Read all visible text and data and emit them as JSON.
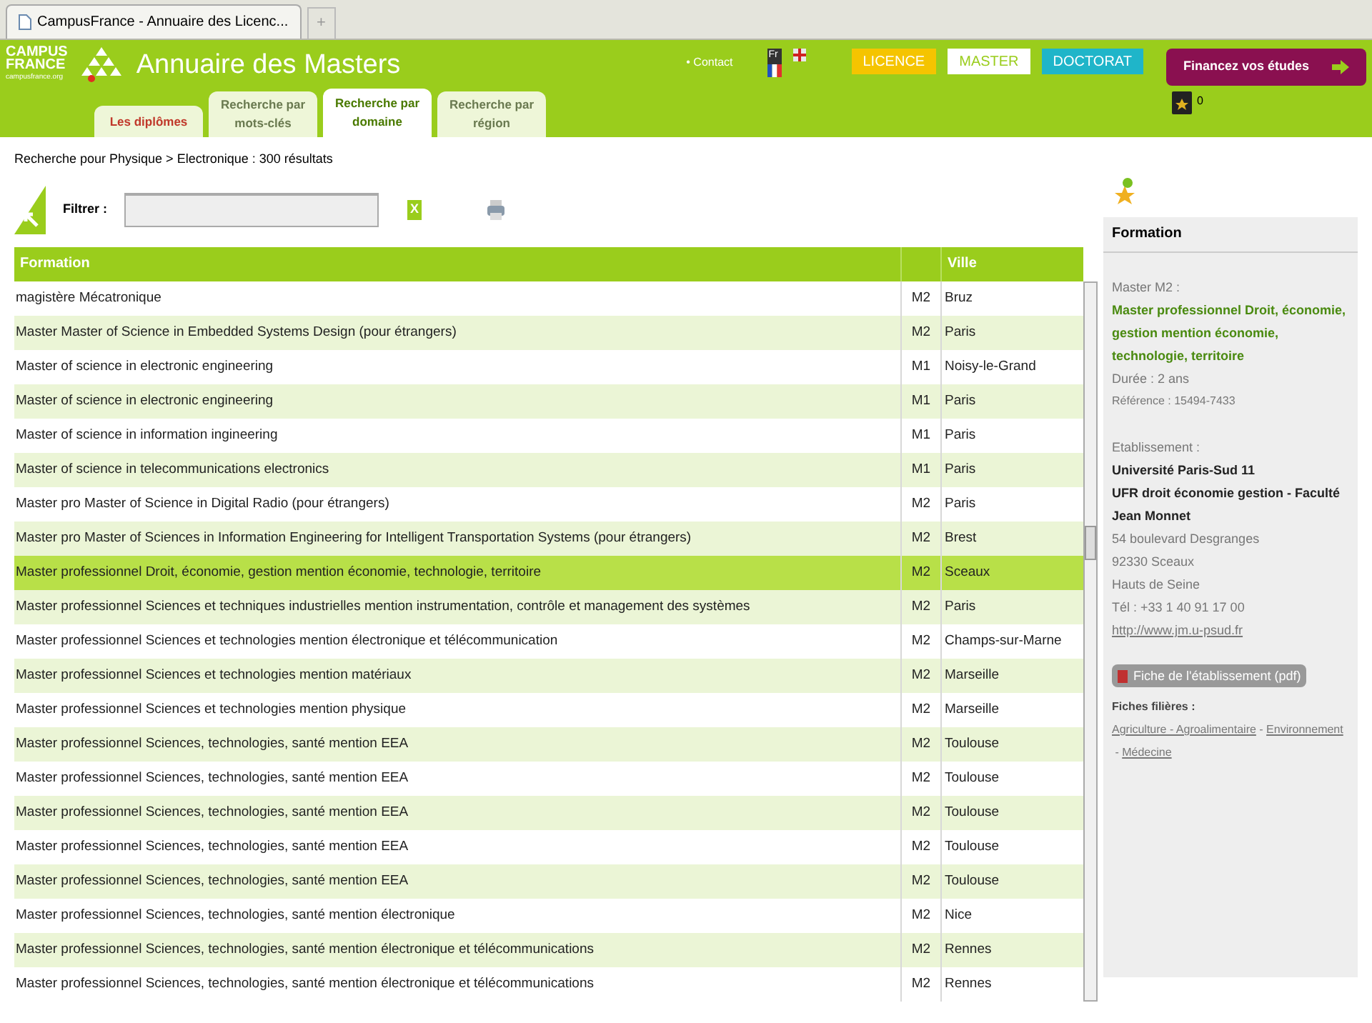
{
  "browser_tab": {
    "title": "CampusFrance - Annuaire des Licenc...",
    "new_tab": "+"
  },
  "header": {
    "logo_line1": "CAMPUS",
    "logo_line2": "FRANCE",
    "logo_url": "campusfrance.org",
    "title": "Annuaire des Masters",
    "contact": "• Contact",
    "language": "Fr",
    "favorites_count": "0",
    "finance_button": "Financez vos études"
  },
  "levels": [
    {
      "label": "LICENCE",
      "color": "#f5c400",
      "selected": false
    },
    {
      "label": "MASTER",
      "color": "#ffffff",
      "selected": true
    },
    {
      "label": "DOCTORAT",
      "color": "#1fb5c9",
      "selected": false
    }
  ],
  "tabs": [
    {
      "label": "Les diplômes",
      "selected": false,
      "kind": "main"
    },
    {
      "label": "Recherche par mots-clés",
      "selected": false,
      "kind": "search"
    },
    {
      "label": "Recherche par domaine",
      "selected": true,
      "kind": "search"
    },
    {
      "label": "Recherche par région",
      "selected": false,
      "kind": "search"
    }
  ],
  "breadcrumb": "Recherche pour Physique > Electronique : 300 résultats",
  "filter": {
    "label": "Filtrer :",
    "clear": "X"
  },
  "table": {
    "columns": [
      "Formation",
      "Ville"
    ],
    "rows": [
      {
        "formation": "magistère Mécatronique",
        "level": "M2",
        "city": "Bruz",
        "selected": false
      },
      {
        "formation": "Master Master of Science in Embedded Systems Design (pour étrangers)",
        "level": "M2",
        "city": "Paris",
        "selected": false
      },
      {
        "formation": "Master of science in electronic engineering",
        "level": "M1",
        "city": "Noisy-le-Grand",
        "selected": false
      },
      {
        "formation": "Master of science in electronic engineering",
        "level": "M1",
        "city": "Paris",
        "selected": false
      },
      {
        "formation": "Master of science in information ingineering",
        "level": "M1",
        "city": "Paris",
        "selected": false
      },
      {
        "formation": "Master of science in telecommunications electronics",
        "level": "M1",
        "city": "Paris",
        "selected": false
      },
      {
        "formation": "Master pro Master of Science in Digital Radio (pour étrangers)",
        "level": "M2",
        "city": "Paris",
        "selected": false
      },
      {
        "formation": "Master pro Master of Sciences in Information Engineering for Intelligent Transportation Systems (pour étrangers)",
        "level": "M2",
        "city": "Brest",
        "selected": false
      },
      {
        "formation": "Master professionnel Droit, économie, gestion mention économie, technologie, territoire",
        "level": "M2",
        "city": "Sceaux",
        "selected": true
      },
      {
        "formation": "Master professionnel Sciences et techniques industrielles mention instrumentation, contrôle et management des systèmes",
        "level": "M2",
        "city": "Paris",
        "selected": false
      },
      {
        "formation": "Master professionnel Sciences et technologies mention électronique et télécommunication",
        "level": "M2",
        "city": "Champs-sur-Marne",
        "selected": false
      },
      {
        "formation": "Master professionnel Sciences et technologies mention matériaux",
        "level": "M2",
        "city": "Marseille",
        "selected": false
      },
      {
        "formation": "Master professionnel Sciences et technologies mention physique",
        "level": "M2",
        "city": "Marseille",
        "selected": false
      },
      {
        "formation": "Master professionnel Sciences, technologies, santé mention EEA",
        "level": "M2",
        "city": "Toulouse",
        "selected": false
      },
      {
        "formation": "Master professionnel Sciences, technologies, santé mention EEA",
        "level": "M2",
        "city": "Toulouse",
        "selected": false
      },
      {
        "formation": "Master professionnel Sciences, technologies, santé mention EEA",
        "level": "M2",
        "city": "Toulouse",
        "selected": false
      },
      {
        "formation": "Master professionnel Sciences, technologies, santé mention EEA",
        "level": "M2",
        "city": "Toulouse",
        "selected": false
      },
      {
        "formation": "Master professionnel Sciences, technologies, santé mention EEA",
        "level": "M2",
        "city": "Toulouse",
        "selected": false
      },
      {
        "formation": "Master professionnel Sciences, technologies, santé mention électronique",
        "level": "M2",
        "city": "Nice",
        "selected": false
      },
      {
        "formation": "Master professionnel Sciences, technologies, santé mention électronique et télécommunications",
        "level": "M2",
        "city": "Rennes",
        "selected": false
      },
      {
        "formation": "Master professionnel Sciences, technologies, santé mention électronique et télécommunications",
        "level": "M2",
        "city": "Rennes",
        "selected": false
      }
    ]
  },
  "detail": {
    "heading": "Formation",
    "type": "Master M2 :",
    "title": "Master professionnel Droit, économie, gestion mention économie, technologie, territoire",
    "duration": "Durée : 2 ans",
    "reference": "Référence : 15494-7433",
    "establishment_label": "Etablissement :",
    "university": "Université Paris-Sud 11",
    "faculty": "UFR droit économie gestion - Faculté Jean Monnet",
    "address": [
      "54 boulevard Desgranges",
      "92330 Sceaux",
      "Hauts de Seine",
      "Tél : +33 1 40 91 17 00"
    ],
    "website": "http://www.jm.u-psud.fr",
    "pdf_button": "Fiche de l'établissement (pdf)",
    "sectors_label": "Fiches filières :",
    "sectors": [
      "Agriculture - Agroalimentaire",
      "Environnement",
      "Médecine"
    ],
    "sector_separator": " - "
  }
}
